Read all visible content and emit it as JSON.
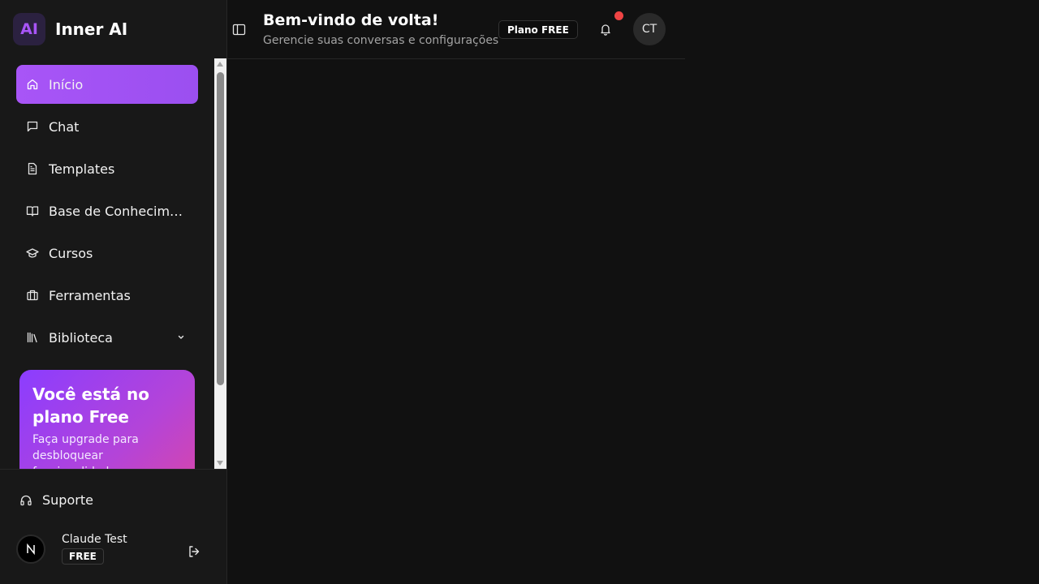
{
  "brand": {
    "logo_text": "AI",
    "name": "Inner AI",
    "accent": "#a855f7"
  },
  "sidebar": {
    "items": [
      {
        "label": "Início",
        "icon": "home-icon",
        "active": true
      },
      {
        "label": "Chat",
        "icon": "chat-bubble-icon"
      },
      {
        "label": "Templates",
        "icon": "document-icon"
      },
      {
        "label": "Base de Conhecimento",
        "icon": "book-icon"
      },
      {
        "label": "Cursos",
        "icon": "graduation-cap-icon"
      },
      {
        "label": "Ferramentas",
        "icon": "toolbox-icon"
      },
      {
        "label": "Biblioteca",
        "icon": "library-icon",
        "has_chevron": true
      }
    ],
    "promo": {
      "title": "Você está no plano Free",
      "text": "Faça upgrade para desbloquear funcionalidades"
    },
    "support_label": "Suporte",
    "user": {
      "avatar_letter": "N",
      "name": "Claude Test",
      "plan": "FREE"
    }
  },
  "header": {
    "title": "Bem-vindo de volta!",
    "subtitle": "Gerencie suas conversas e configurações",
    "plan_badge": "Plano FREE",
    "avatar_initials": "CT",
    "notification_dot_color": "#ef4444"
  }
}
